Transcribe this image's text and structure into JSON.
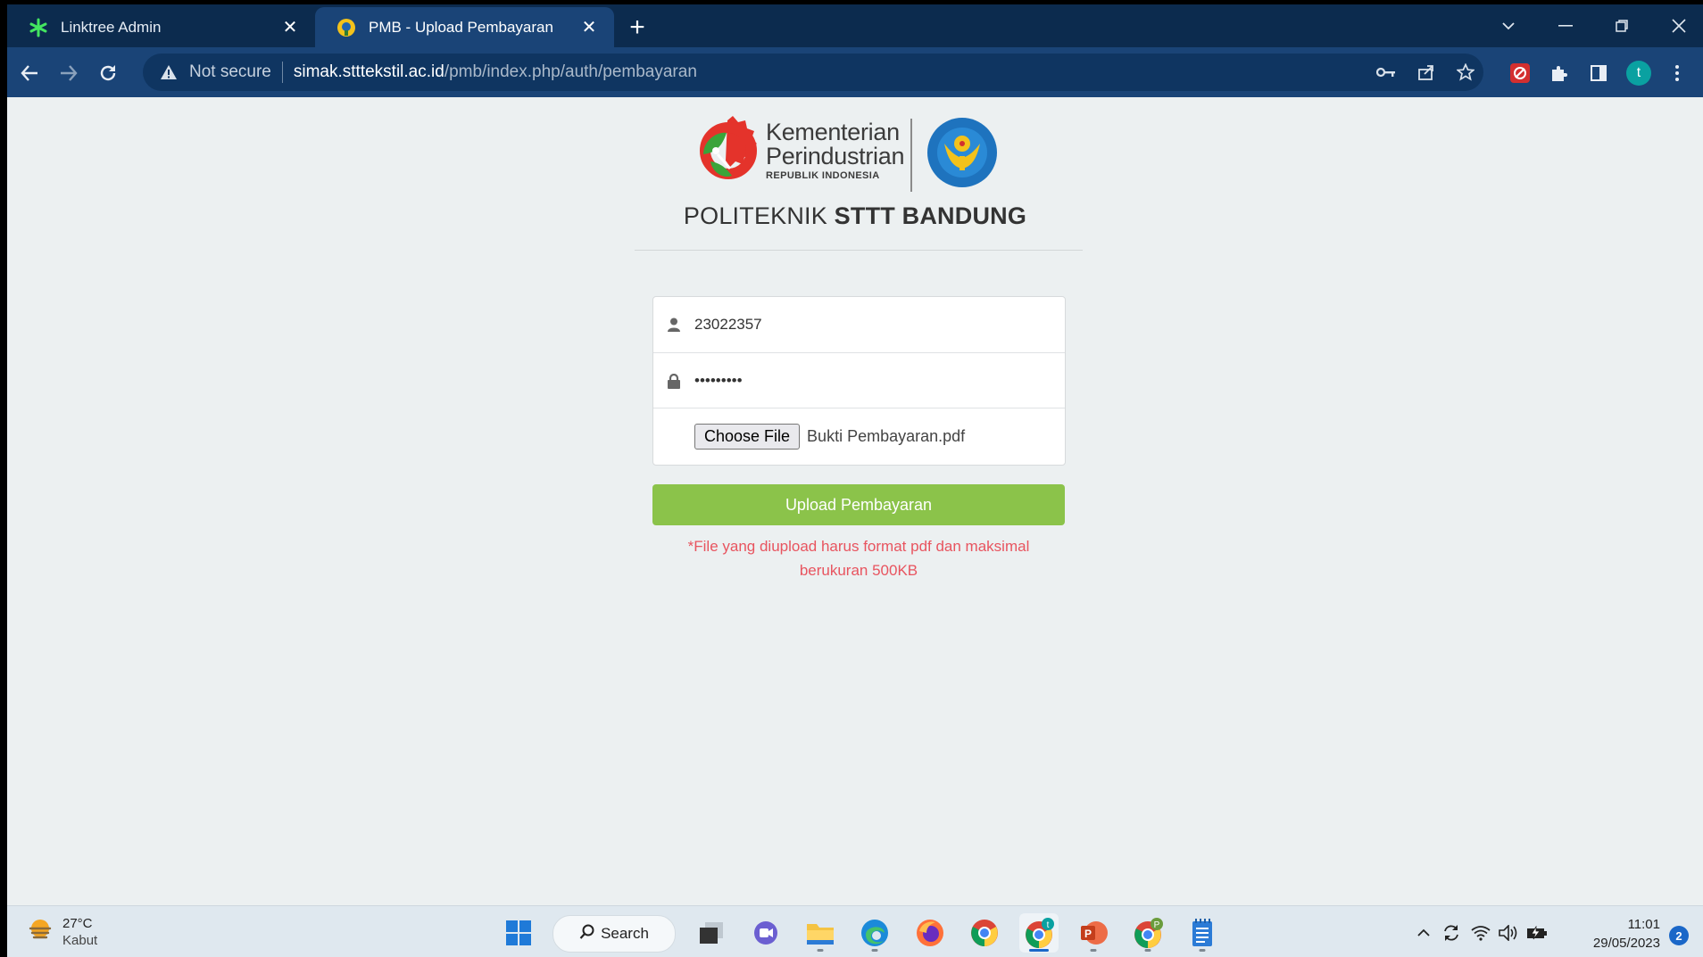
{
  "browser": {
    "tabs": [
      {
        "title": "Linktree Admin",
        "favicon": "linktree-icon",
        "active": false
      },
      {
        "title": "PMB - Upload Pembayaran",
        "favicon": "polteksttt-icon",
        "active": true
      }
    ],
    "security_label": "Not secure",
    "url_host": "simak.stttekstil.ac.id",
    "url_path": "/pmb/index.php/auth/pembayaran",
    "profile_initial": "t"
  },
  "page": {
    "logo": {
      "line1": "Kementerian",
      "line2": "Perindustrian",
      "line3": "REPUBLIK INDONESIA"
    },
    "title_regular": "POLITEKNIK ",
    "title_bold": "STTT BANDUNG",
    "form": {
      "username_value": "23022357",
      "password_mask": "•••••••••",
      "file_button": "Choose File",
      "file_name": "Bukti Pembayaran.pdf"
    },
    "submit_label": "Upload Pembayaran",
    "note": "*File yang diupload harus format pdf dan maksimal berukuran 500KB"
  },
  "taskbar": {
    "weather_temp": "27°C",
    "weather_desc": "Kabut",
    "search_label": "Search",
    "time": "11:01",
    "date": "29/05/2023",
    "notification_count": "2"
  },
  "colors": {
    "accent_green": "#8bc34a",
    "note_red": "#e8545f",
    "tab_dark": "#0c2b4e",
    "toolbar_blue": "#1a4477"
  }
}
